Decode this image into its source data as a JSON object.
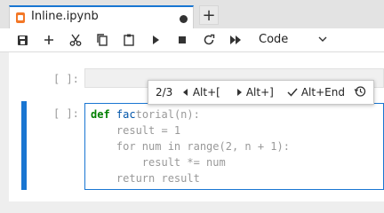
{
  "tab": {
    "title": "Inline.ipynb",
    "add_label": "+"
  },
  "toolbar": {
    "buttons": [
      "save-icon",
      "add-cell-icon",
      "cut-icon",
      "copy-icon",
      "paste-icon",
      "run-icon",
      "stop-icon",
      "restart-icon",
      "fast-forward-icon"
    ],
    "cell_type": "Code"
  },
  "cells": [
    {
      "prompt": "[ ]:"
    },
    {
      "prompt": "[ ]:",
      "code": [
        {
          "kw": "def",
          "fn": "fac",
          "rest": "torial(n):"
        },
        {
          "text": "    result = 1"
        },
        {
          "text": "    for num in range(2, n + 1):"
        },
        {
          "text": "        result *= num"
        },
        {
          "text": "    return result"
        }
      ]
    }
  ],
  "inline_completer": {
    "counter": "2/3",
    "prev_shortcut": "Alt+[",
    "next_shortcut": "Alt+]",
    "accept_shortcut": "Alt+End"
  },
  "colors": {
    "accent": "#1976d2",
    "tab_icon": "#f37726"
  }
}
